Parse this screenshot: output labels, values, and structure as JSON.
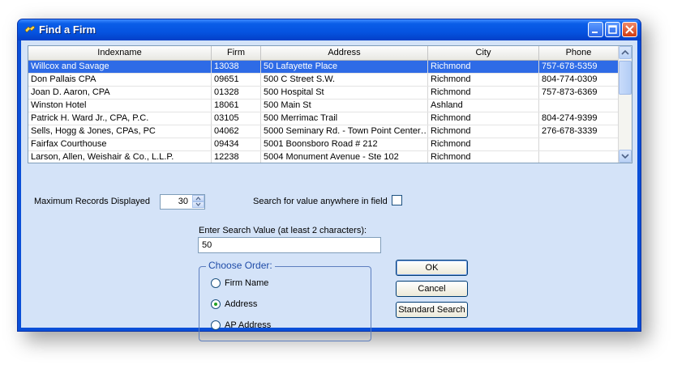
{
  "window": {
    "title": "Find a Firm"
  },
  "grid": {
    "columns": [
      "Indexname",
      "Firm",
      "Address",
      "City",
      "Phone"
    ],
    "rows": [
      [
        "Willcox and Savage",
        "13038",
        "50 Lafayette Place",
        "Richmond",
        "757-678-5359"
      ],
      [
        "Don Pallais CPA",
        "09651",
        "500 C Street S.W.",
        "Richmond",
        "804-774-0309"
      ],
      [
        "Joan D. Aaron, CPA",
        "01328",
        "500 Hospital St",
        "Richmond",
        "757-873-6369"
      ],
      [
        "Winston Hotel",
        "18061",
        "500 Main St",
        "Ashland",
        ""
      ],
      [
        "Patrick H. Ward Jr., CPA, P.C.",
        "03105",
        "500 Merrimac Trail",
        "Richmond",
        "804-274-9399"
      ],
      [
        "Sells, Hogg & Jones, CPAs, PC",
        "04062",
        "5000 Seminary Rd. - Town Point Center…",
        "Richmond",
        "276-678-3339"
      ],
      [
        "Fairfax Courthouse",
        "09434",
        "5001 Boonsboro Road # 212",
        "Richmond",
        ""
      ],
      [
        "Larson, Allen, Weishair & Co., L.L.P.",
        "12238",
        "5004 Monument Avenue - Ste 102",
        "Richmond",
        ""
      ]
    ],
    "selected_row": 0
  },
  "form": {
    "max_records_label": "Maximum Records Displayed",
    "max_records_value": "30",
    "search_anywhere_label": "Search for value anywhere in field",
    "search_anywhere_checked": false,
    "search_value_label": "Enter Search Value (at least 2 characters):",
    "search_value": "50"
  },
  "order": {
    "legend": "Choose Order:",
    "options": [
      "Firm Name",
      "Address",
      "AP Address"
    ],
    "selected": "Address"
  },
  "buttons": {
    "ok": "OK",
    "cancel": "Cancel",
    "standard_search": "Standard Search"
  },
  "colors": {
    "selection": "#2e6be6",
    "titlebar": "#0553e0",
    "client_bg": "#d4e3f8"
  }
}
